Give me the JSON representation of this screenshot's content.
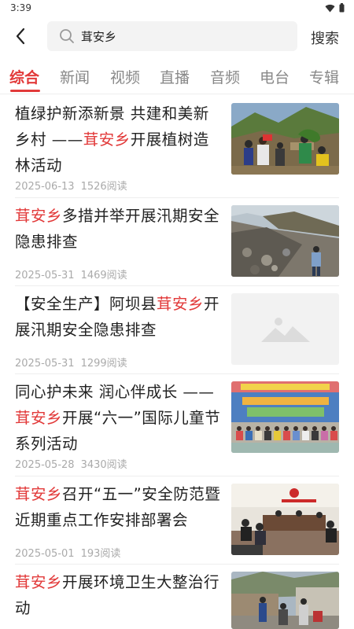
{
  "status_bar": {
    "time": "3:39"
  },
  "search": {
    "query": "茸安乡",
    "button_label": "搜索"
  },
  "tabs": [
    {
      "label": "综合"
    },
    {
      "label": "新闻"
    },
    {
      "label": "视频"
    },
    {
      "label": "直播"
    },
    {
      "label": "音频"
    },
    {
      "label": "电台"
    },
    {
      "label": "专辑"
    }
  ],
  "active_tab": "综合",
  "highlight_color": "#e23a3a",
  "articles": [
    {
      "title_parts": [
        {
          "text": "植绿护新添新景  共建和美新乡村 ——",
          "highlight": false
        },
        {
          "text": "茸安乡",
          "highlight": true
        },
        {
          "text": "开展植树造林活动",
          "highlight": false
        }
      ],
      "date": "2025-06-13",
      "reads": "1526阅读",
      "thumbnail": "photo-tree-planting"
    },
    {
      "title_parts": [
        {
          "text": "茸安乡",
          "highlight": true
        },
        {
          "text": "多措并举开展汛期安全隐患排查",
          "highlight": false
        }
      ],
      "date": "2025-05-31",
      "reads": "1469阅读",
      "thumbnail": "photo-landslide-road"
    },
    {
      "title_parts": [
        {
          "text": "【安全生产】阿坝县",
          "highlight": false
        },
        {
          "text": "茸安乡",
          "highlight": true
        },
        {
          "text": "开展汛期安全隐患排查",
          "highlight": false
        }
      ],
      "date": "2025-05-31",
      "reads": "1299阅读",
      "thumbnail": "image-placeholder"
    },
    {
      "title_parts": [
        {
          "text": "同心护未来 润心伴成长 ——",
          "highlight": false
        },
        {
          "text": "茸安乡",
          "highlight": true
        },
        {
          "text": "开展“六一”国际儿童节系列活动",
          "highlight": false
        }
      ],
      "date": "2025-05-28",
      "reads": "3430阅读",
      "thumbnail": "photo-childrens-day-stage"
    },
    {
      "title_parts": [
        {
          "text": "茸安乡",
          "highlight": true
        },
        {
          "text": "召开“五一”安全防范暨近期重点工作安排部署会",
          "highlight": false
        }
      ],
      "date": "2025-05-01",
      "reads": "193阅读",
      "thumbnail": "photo-meeting-room"
    },
    {
      "title_parts": [
        {
          "text": "茸安乡",
          "highlight": true
        },
        {
          "text": "开展环境卫生大整治行动",
          "highlight": false
        }
      ],
      "date": "",
      "reads": "",
      "thumbnail": "photo-sanitation-cleanup"
    }
  ]
}
